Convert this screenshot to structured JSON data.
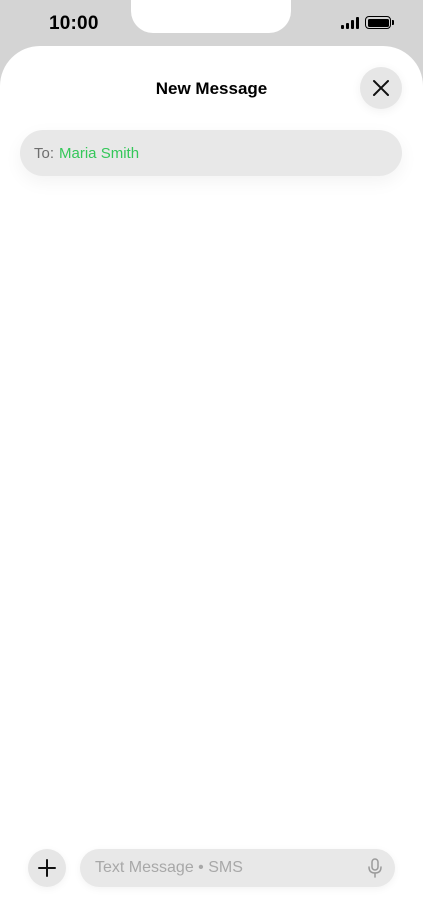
{
  "status_bar": {
    "time": "10:00",
    "signal_icon": "cellular-signal-icon",
    "battery_icon": "battery-full-icon"
  },
  "sheet": {
    "title": "New Message",
    "close_icon": "close-icon"
  },
  "to_field": {
    "label": "To:",
    "recipient": "Maria Smith",
    "recipient_color": "#34c759"
  },
  "composer": {
    "add_icon": "plus-icon",
    "placeholder": "Text Message • SMS",
    "value": "",
    "mic_icon": "microphone-icon"
  }
}
